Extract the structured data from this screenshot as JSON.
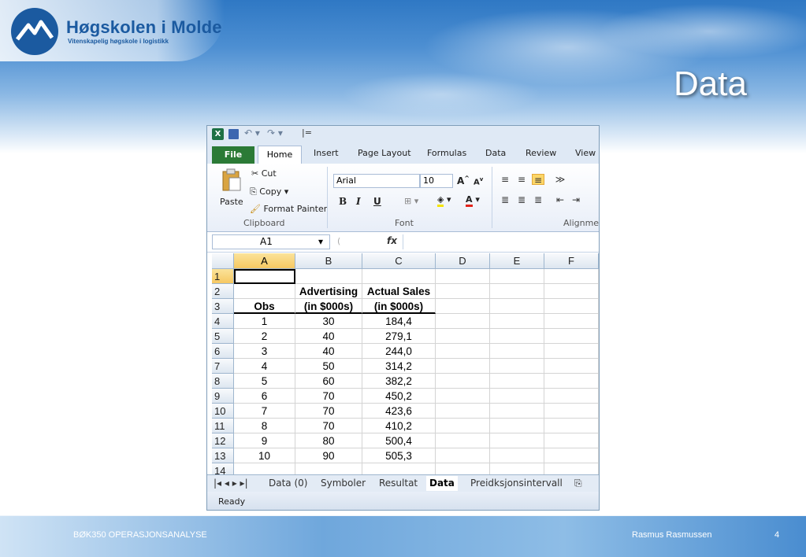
{
  "slide": {
    "logo_name": "Høgskolen i Molde",
    "logo_sub": "Vitenskapelig høgskole i logistikk",
    "title": "Data",
    "footer_left": "BØK350 OPERASJONSANALYSE",
    "footer_author": "Rasmus Rasmussen",
    "page_number": "4"
  },
  "excel": {
    "tabs": [
      "File",
      "Home",
      "Insert",
      "Page Layout",
      "Formulas",
      "Data",
      "Review",
      "View"
    ],
    "clipboard": {
      "paste": "Paste",
      "cut": "Cut",
      "copy": "Copy",
      "format_painter": "Format Painter",
      "label": "Clipboard"
    },
    "font": {
      "name": "Arial",
      "size": "10",
      "label": "Font",
      "bold": "B",
      "italic": "I",
      "underline": "U"
    },
    "alignment_label": "Alignmen",
    "name_box": "A1",
    "fx": "fx",
    "columns": [
      "A",
      "B",
      "C",
      "D",
      "E",
      "F"
    ],
    "rows": [
      "1",
      "2",
      "3",
      "4",
      "5",
      "6",
      "7",
      "8",
      "9",
      "10",
      "11",
      "12",
      "13",
      "14"
    ],
    "header_row2": [
      "",
      "Advertising",
      "Actual Sales"
    ],
    "header_row3": [
      "Obs",
      "(in $000s)",
      "(in $000s)"
    ],
    "data": [
      [
        "1",
        "30",
        "184,4"
      ],
      [
        "2",
        "40",
        "279,1"
      ],
      [
        "3",
        "40",
        "244,0"
      ],
      [
        "4",
        "50",
        "314,2"
      ],
      [
        "5",
        "60",
        "382,2"
      ],
      [
        "6",
        "70",
        "450,2"
      ],
      [
        "7",
        "70",
        "423,6"
      ],
      [
        "8",
        "70",
        "410,2"
      ],
      [
        "9",
        "80",
        "500,4"
      ],
      [
        "10",
        "90",
        "505,3"
      ]
    ],
    "sheet_tabs": [
      "Data (0)",
      "Symboler",
      "Resultat",
      "Data",
      "Preidksjonsintervall"
    ],
    "active_sheet": "Data",
    "status": "Ready",
    "colors": {
      "file_tab": "#2b7a36",
      "selection": "#f6c862"
    }
  }
}
